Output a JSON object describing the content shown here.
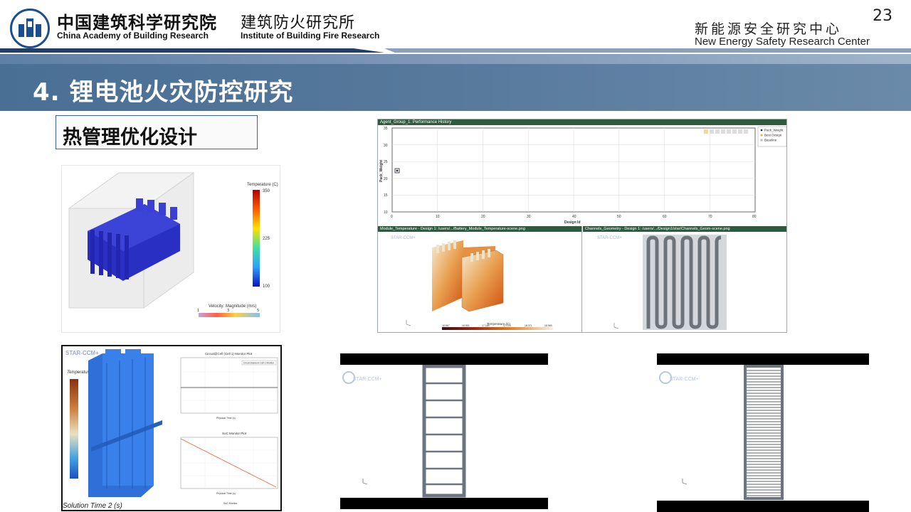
{
  "header": {
    "academy_cn": "中国建筑科学研究院",
    "academy_en": "China Academy of Building Research",
    "institute_cn": "建筑防火研究所",
    "institute_en": "Institute of Building Fire Research",
    "center_cn": "新能源安全研究中心",
    "center_en": "New Energy Safety Research Center",
    "page_number": "23"
  },
  "title": "4. 锂电池火灾防控研究",
  "subtitle": "热管理优化设计",
  "colors": {
    "brand_blue": "#1b4d92",
    "title_band": "#55789b",
    "panel_header": "#2e5b3e"
  },
  "panel1": {
    "legend_title": "Temperature (C)",
    "legend_ticks": [
      "350",
      "225",
      "100"
    ],
    "velocity_title": "Velocity: Magnitude (m/s)",
    "velocity_ticks": [
      "1",
      "3",
      "5"
    ]
  },
  "panel2": {
    "history_title": "Agent_Group_1: Performance History",
    "ylabel": "Pack_Weight",
    "xlabel": "Design Id",
    "y_ticks": [
      "35",
      "30",
      "25",
      "20",
      "15",
      "10"
    ],
    "x_ticks": [
      "0",
      "10",
      "20",
      "30",
      "40",
      "50",
      "60",
      "70",
      "80"
    ],
    "legend": [
      "Pack_Weight",
      "Best Design",
      "Baseline"
    ],
    "module_title": "Module_Temperature - Design 1: /users/.../Battery_Module_Temperature-scene.png",
    "channels_title": "Channels_Geometry - Design 1: /users/.../Design1/star/Channels_Geom-scene.png",
    "temp_label": "Temperature (C)",
    "temp_ticks": [
      "16.667",
      "16.951",
      "17.189",
      "17.774",
      "18.371",
      "18.960"
    ],
    "logo": "STAR-CCM+"
  },
  "panel3": {
    "logo": "STAR-CCM+",
    "legend_title": "Temperature (K)",
    "chart1_title": "Circuit@Cell (Cell 1) Monitor Plot",
    "chart1_legend": "Circuit Element: Cell 1 Monitor",
    "chart1_xlabel": "Physical Time (s)",
    "chart2_title": "SoC Monitor Plot",
    "chart2_xlabel": "Physical Time (s)",
    "chart2_legend": "SoC Monitor",
    "solution_time": "Solution Time 2 (s)"
  },
  "panel4": {
    "logo": "STAR-CCM+"
  },
  "panel5": {
    "logo": "STAR-CCM+"
  }
}
